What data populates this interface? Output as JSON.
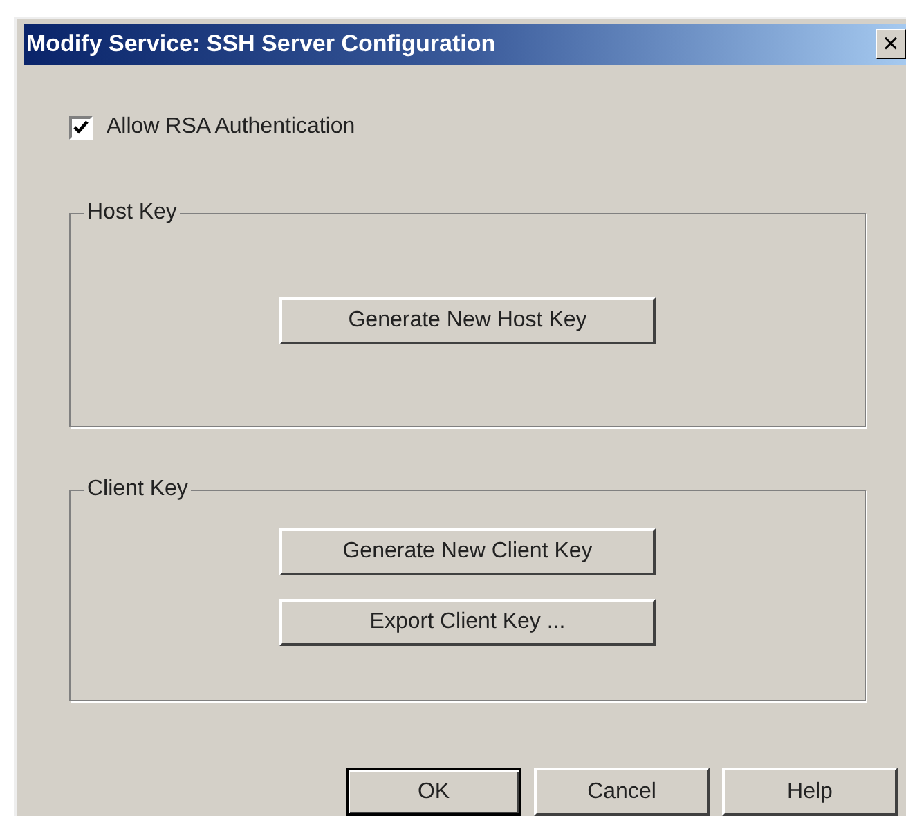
{
  "window": {
    "title": "Modify Service: SSH Server Configuration",
    "close": "×"
  },
  "allow_rsa": {
    "label": "Allow RSA Authentication",
    "checked": true
  },
  "groups": [
    {
      "title": "Host Key",
      "buttons": [
        "Generate New Host Key"
      ]
    },
    {
      "title": "Client Key",
      "buttons": [
        "Generate New Client Key",
        "Export Client Key ..."
      ]
    }
  ],
  "buttons": [
    {
      "label": "OK",
      "default": true
    },
    {
      "label": "Cancel",
      "default": false
    },
    {
      "label": "Help",
      "default": false
    }
  ]
}
